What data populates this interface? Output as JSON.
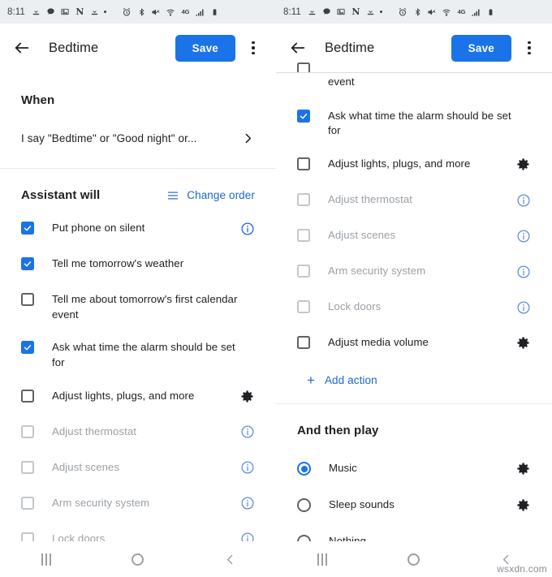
{
  "statusbar": {
    "time": "8:11",
    "icons": [
      "download-icon",
      "message-icon",
      "photo-icon",
      "netflix-icon",
      "download-icon",
      "dot-icon",
      "alarm-icon",
      "bluetooth-icon",
      "mute-icon",
      "wifi-icon",
      "4g-icon",
      "signal-icon",
      "battery-icon"
    ],
    "network_label": "4G"
  },
  "toolbar": {
    "back_label": "back",
    "title": "Bedtime",
    "save_label": "Save",
    "more_label": "More options"
  },
  "colors": {
    "accent": "#1a73e8",
    "link": "#1967d2",
    "text": "#202124",
    "disabled_text": "#9aa0a6",
    "statusbar_bg": "#eceff1",
    "divider": "#e8eaed"
  },
  "left": {
    "when": {
      "title": "When",
      "value": "I say \"Bedtime\" or \"Good night\" or...",
      "chevron": "chevron-right-icon"
    },
    "assistant": {
      "title": "Assistant will",
      "change_order_label": "Change order",
      "items": [
        {
          "label": "Put phone on silent",
          "checked": true,
          "disabled": false,
          "trailing": "info-icon"
        },
        {
          "label": "Tell me tomorrow's weather",
          "checked": true,
          "disabled": false,
          "trailing": ""
        },
        {
          "label": "Tell me about tomorrow's first calendar event",
          "checked": false,
          "disabled": false,
          "trailing": ""
        },
        {
          "label": "Ask what time the alarm should be set for",
          "checked": true,
          "disabled": false,
          "trailing": ""
        },
        {
          "label": "Adjust lights, plugs, and more",
          "checked": false,
          "disabled": false,
          "trailing": "gear-icon"
        },
        {
          "label": "Adjust thermostat",
          "checked": false,
          "disabled": true,
          "trailing": "info-icon"
        },
        {
          "label": "Adjust scenes",
          "checked": false,
          "disabled": true,
          "trailing": "info-icon"
        },
        {
          "label": "Arm security system",
          "checked": false,
          "disabled": true,
          "trailing": "info-icon"
        },
        {
          "label": "Lock doors",
          "checked": false,
          "disabled": true,
          "trailing": "info-icon"
        }
      ]
    }
  },
  "right": {
    "clipped_item": {
      "label": "event",
      "checked": false,
      "disabled": false
    },
    "assistant_items": [
      {
        "label": "Ask what time the alarm should be set for",
        "checked": true,
        "disabled": false,
        "trailing": ""
      },
      {
        "label": "Adjust lights, plugs, and more",
        "checked": false,
        "disabled": false,
        "trailing": "gear-icon"
      },
      {
        "label": "Adjust thermostat",
        "checked": false,
        "disabled": true,
        "trailing": "info-icon"
      },
      {
        "label": "Adjust scenes",
        "checked": false,
        "disabled": true,
        "trailing": "info-icon"
      },
      {
        "label": "Arm security system",
        "checked": false,
        "disabled": true,
        "trailing": "info-icon"
      },
      {
        "label": "Lock doors",
        "checked": false,
        "disabled": true,
        "trailing": "info-icon"
      },
      {
        "label": "Adjust media volume",
        "checked": false,
        "disabled": false,
        "trailing": "gear-icon"
      }
    ],
    "add_action_label": "Add action",
    "play": {
      "title": "And then play",
      "options": [
        {
          "label": "Music",
          "selected": true,
          "trailing": "gear-icon"
        },
        {
          "label": "Sleep sounds",
          "selected": false,
          "trailing": "gear-icon"
        },
        {
          "label": "Nothing",
          "selected": false,
          "trailing": ""
        }
      ]
    }
  },
  "navbar": {
    "recents_label": "Recent apps",
    "home_label": "Home",
    "back_label": "Back"
  },
  "watermark": "wsxdn.com"
}
